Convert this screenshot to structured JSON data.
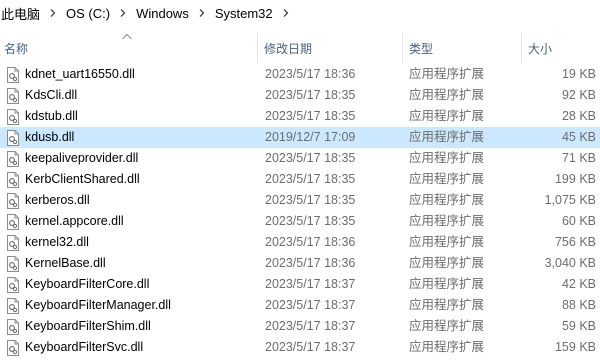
{
  "breadcrumb": [
    "此电脑",
    "OS (C:)",
    "Windows",
    "System32"
  ],
  "columns": {
    "name": "名称",
    "date": "修改日期",
    "type": "类型",
    "size": "大小"
  },
  "files": [
    {
      "name": "kdnet_uart16550.dll",
      "date": "2023/5/17 18:36",
      "type": "应用程序扩展",
      "size": "19 KB"
    },
    {
      "name": "KdsCli.dll",
      "date": "2023/5/17 18:35",
      "type": "应用程序扩展",
      "size": "92 KB"
    },
    {
      "name": "kdstub.dll",
      "date": "2023/5/17 18:35",
      "type": "应用程序扩展",
      "size": "28 KB"
    },
    {
      "name": "kdusb.dll",
      "date": "2019/12/7 17:09",
      "type": "应用程序扩展",
      "size": "45 KB"
    },
    {
      "name": "keepaliveprovider.dll",
      "date": "2023/5/17 18:35",
      "type": "应用程序扩展",
      "size": "71 KB"
    },
    {
      "name": "KerbClientShared.dll",
      "date": "2023/5/17 18:35",
      "type": "应用程序扩展",
      "size": "199 KB"
    },
    {
      "name": "kerberos.dll",
      "date": "2023/5/17 18:35",
      "type": "应用程序扩展",
      "size": "1,075 KB"
    },
    {
      "name": "kernel.appcore.dll",
      "date": "2023/5/17 18:35",
      "type": "应用程序扩展",
      "size": "60 KB"
    },
    {
      "name": "kernel32.dll",
      "date": "2023/5/17 18:36",
      "type": "应用程序扩展",
      "size": "756 KB"
    },
    {
      "name": "KernelBase.dll",
      "date": "2023/5/17 18:36",
      "type": "应用程序扩展",
      "size": "3,040 KB"
    },
    {
      "name": "KeyboardFilterCore.dll",
      "date": "2023/5/17 18:37",
      "type": "应用程序扩展",
      "size": "42 KB"
    },
    {
      "name": "KeyboardFilterManager.dll",
      "date": "2023/5/17 18:37",
      "type": "应用程序扩展",
      "size": "88 KB"
    },
    {
      "name": "KeyboardFilterShim.dll",
      "date": "2023/5/17 18:37",
      "type": "应用程序扩展",
      "size": "59 KB"
    },
    {
      "name": "KeyboardFilterSvc.dll",
      "date": "2023/5/17 18:37",
      "type": "应用程序扩展",
      "size": "159 KB"
    }
  ],
  "selected_file": "kdusb.dll",
  "colors": {
    "selected_row": "#cce8ff",
    "header_text": "#4c607a",
    "secondary_text": "#6d6d6d"
  },
  "icons": {
    "file": "dll-file-icon",
    "separator": "chevron-right-icon",
    "sort": "sort-ascending-icon"
  }
}
